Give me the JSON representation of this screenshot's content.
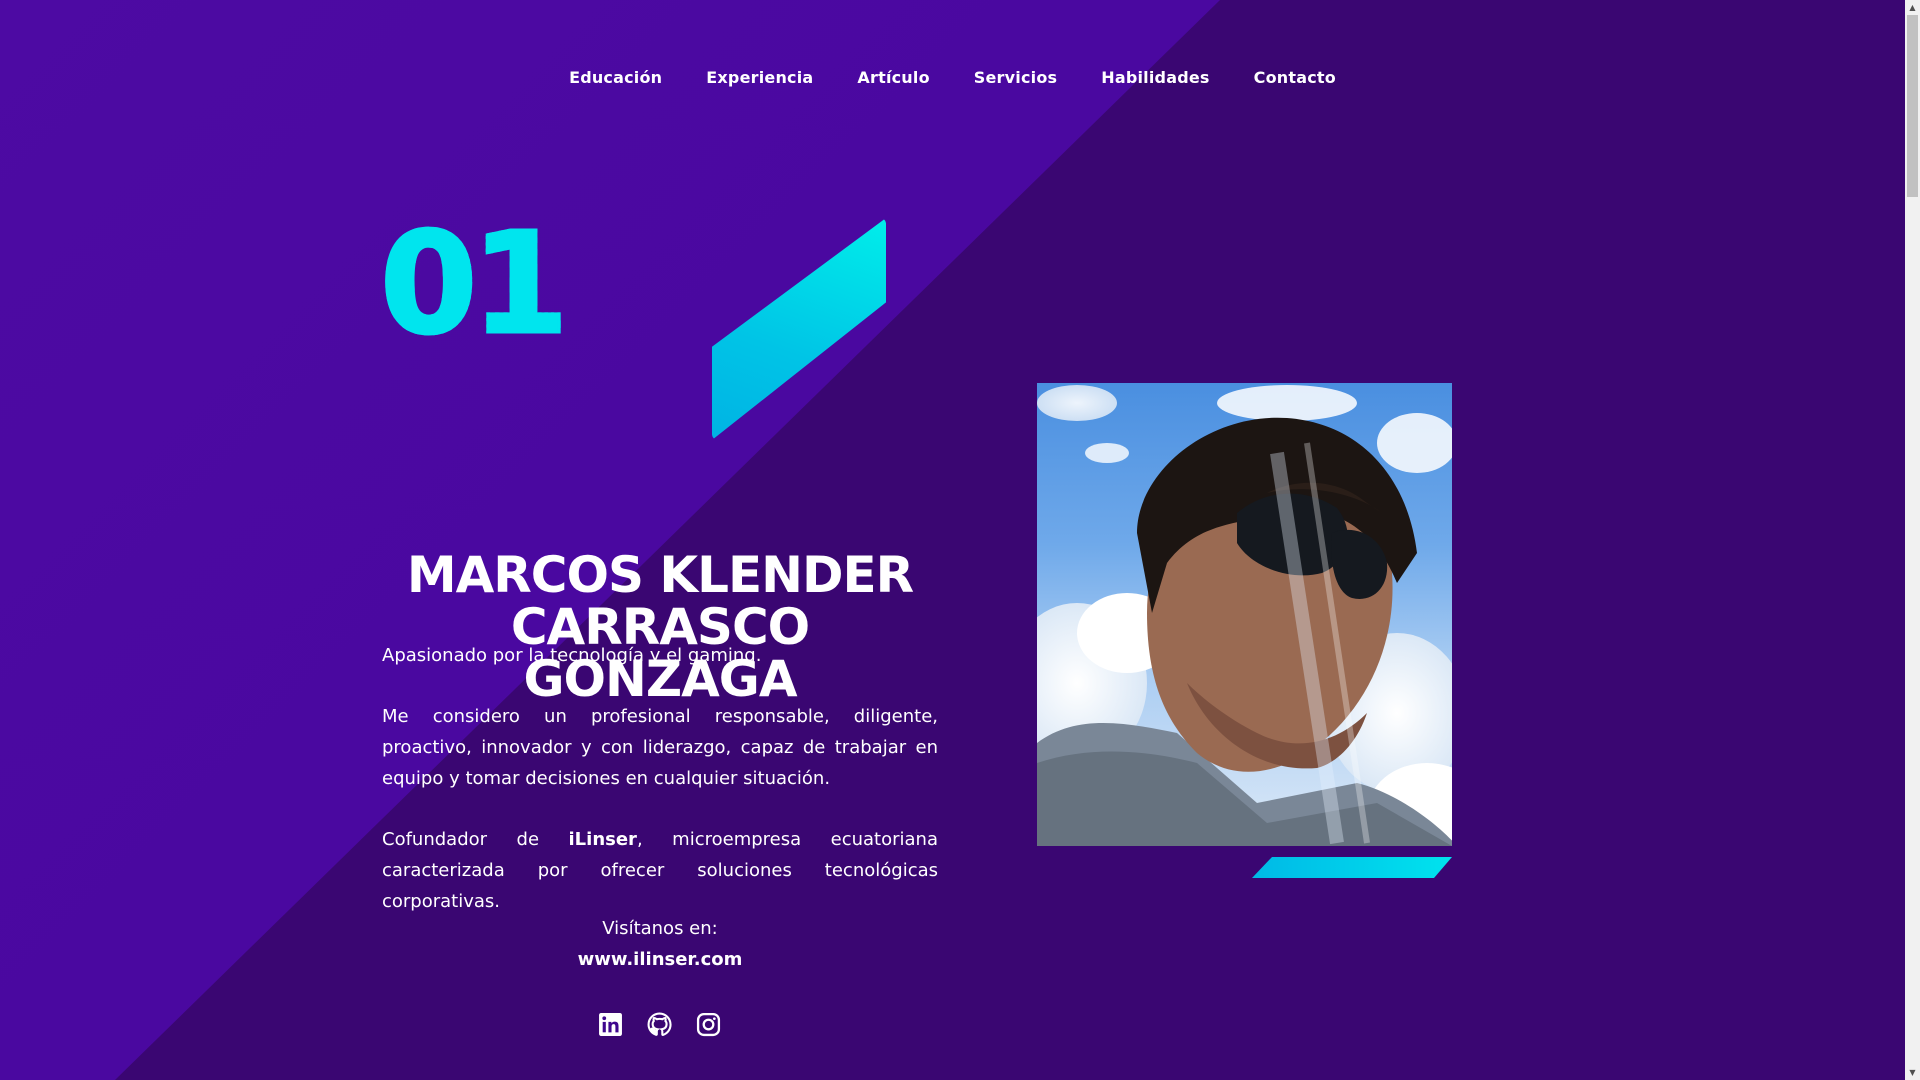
{
  "colors": {
    "background": "#3a0672",
    "diagonal_band": "#4a08a0",
    "accent": "#00e5ee",
    "text": "#ffffff"
  },
  "nav": {
    "items": [
      {
        "label": "Educación"
      },
      {
        "label": "Experiencia"
      },
      {
        "label": "Artículo"
      },
      {
        "label": "Servicios"
      },
      {
        "label": "Habilidades"
      },
      {
        "label": "Contacto"
      }
    ]
  },
  "hero": {
    "section_number": "01",
    "name": "MARCOS KLENDER\nCARRASCO GONZAGA",
    "tagline": "Apasionado por la tecnología y el gaming.",
    "description": "Me considero un profesional responsable, diligente, proactivo, innovador y con liderazgo, capaz de trabajar en equipo y tomar decisiones en cualquier situación.",
    "cofounder_prefix": "Cofundador de ",
    "company": "iLinser",
    "cofounder_suffix": ", microempresa ecuatoriana caracterizada por ofrecer soluciones tecnológicas corporativas.",
    "visit_label": "Visítanos en:",
    "website": "www.ilinser.com"
  },
  "socials": [
    {
      "icon": "linkedin-icon"
    },
    {
      "icon": "github-icon"
    },
    {
      "icon": "instagram-icon"
    }
  ],
  "photo": {
    "subject": "profile-photo"
  }
}
